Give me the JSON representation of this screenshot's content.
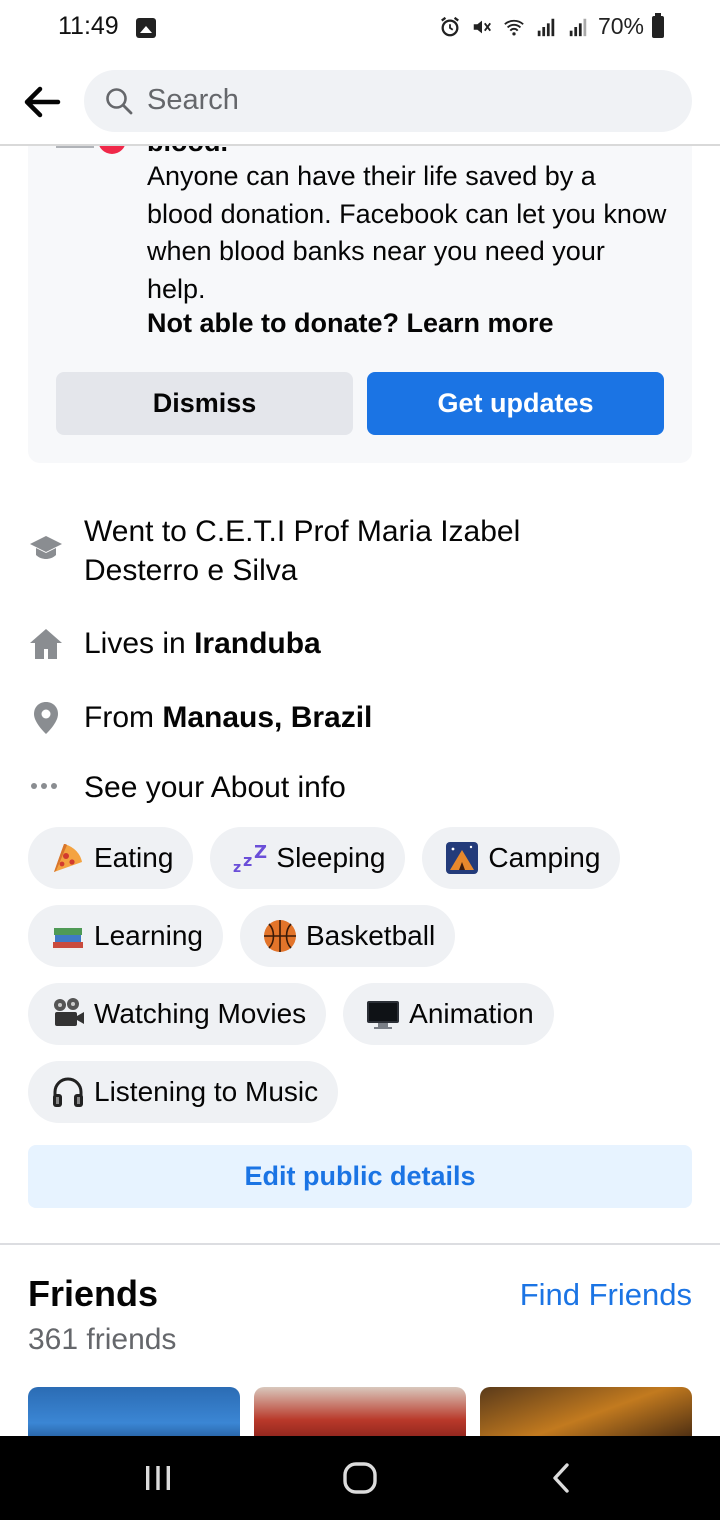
{
  "status_bar": {
    "time": "11:49",
    "battery": "70%"
  },
  "header": {
    "search_placeholder": "Search"
  },
  "blood_card": {
    "title": "blood.",
    "description": "Anyone can have their life saved by a blood donation. Facebook can let you know when blood banks near you need your help.",
    "learn_more": "Not able to donate? Learn more",
    "dismiss_label": "Dismiss",
    "updates_label": "Get updates"
  },
  "details": {
    "education": "Went to C.E.T.I Prof Maria Izabel",
    "education_line2": "Desterro e Silva",
    "lives_prefix": "Lives in ",
    "lives_place": "Iranduba",
    "from_prefix": "From ",
    "from_place": "Manaus, Brazil",
    "about": "See your About info"
  },
  "hobbies": [
    {
      "label": "Eating",
      "icon": "pizza-icon"
    },
    {
      "label": "Sleeping",
      "icon": "zzz-icon"
    },
    {
      "label": "Camping",
      "icon": "camping-icon"
    },
    {
      "label": "Learning",
      "icon": "books-icon"
    },
    {
      "label": "Basketball",
      "icon": "basketball-icon"
    },
    {
      "label": "Watching Movies",
      "icon": "film-projector-icon"
    },
    {
      "label": "Animation",
      "icon": "monitor-icon"
    },
    {
      "label": "Listening to Music",
      "icon": "headphones-icon"
    }
  ],
  "edit_public_details": "Edit public details",
  "friends": {
    "title": "Friends",
    "find_label": "Find Friends",
    "count": "361 friends"
  },
  "colors": {
    "accent": "#1b74e4",
    "chip_bg": "#eff1f4",
    "edit_bg": "#e7f3ff"
  }
}
